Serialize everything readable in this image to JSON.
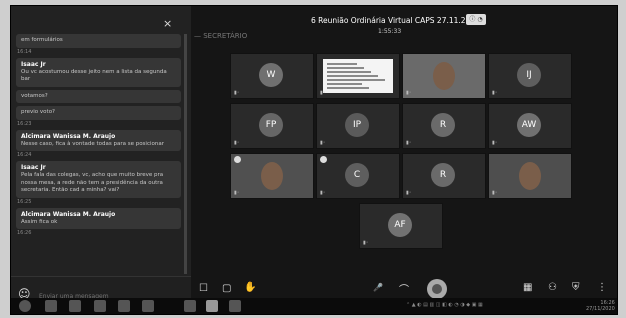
{
  "meeting": {
    "title": "6 Reunião Ordinária Virtual CAPS 27.11.2020",
    "timer": "1:55:33",
    "section_label": "— SECRETÁRIO"
  },
  "chat": {
    "close": "×",
    "messages": [
      {
        "sender": "",
        "text": "em formulários",
        "time": "16:14"
      },
      {
        "sender": "Isaac Jr",
        "text": "Ou vc acostumou desse jeito nem a lista da segunda bar",
        "time": ""
      },
      {
        "sender": "",
        "text": "votamos?",
        "time": ""
      },
      {
        "sender": "",
        "text": "previo voto?",
        "time": "16:23"
      },
      {
        "sender": "Alcimara Wanissa M. Araujo",
        "text": "Nesse caso, fica à vontade todas para se posicionar",
        "time": "16:24"
      },
      {
        "sender": "Isaac Jr",
        "text": "Pela fala das colegas, vc, acho que muito breve pra nossa mesa, a rede não tem a presidência da outra secretaria. Então cad a minha? vai?",
        "time": "16:25"
      },
      {
        "sender": "Alcimara Wanissa M. Araujo",
        "text": "Assim fica ok",
        "time": "16:26"
      }
    ],
    "input_placeholder": "Enviar uma mensagem"
  },
  "participants": [
    {
      "initials": "W",
      "type": "avatar",
      "color": "#707070"
    },
    {
      "initials": "",
      "type": "screen",
      "color": "#f4f4f4"
    },
    {
      "initials": "",
      "type": "video",
      "color": "#6a6a6a"
    },
    {
      "initials": "IJ",
      "type": "avatar",
      "color": "#5e5e5e"
    },
    {
      "initials": "FP",
      "type": "avatar",
      "color": "#666666"
    },
    {
      "initials": "IP",
      "type": "avatar",
      "color": "#5a5a5a"
    },
    {
      "initials": "R",
      "type": "avatar",
      "color": "#6a6a6a"
    },
    {
      "initials": "AW",
      "type": "avatar",
      "color": "#707070"
    },
    {
      "initials": "",
      "type": "video",
      "color": "#505050"
    },
    {
      "initials": "C",
      "type": "avatar",
      "color": "#5e5e5e"
    },
    {
      "initials": "R",
      "type": "avatar",
      "color": "#6a6a6a"
    },
    {
      "initials": "",
      "type": "video",
      "color": "#4e4e4e"
    },
    {
      "initials": "AF",
      "type": "avatar",
      "color": "#727272"
    }
  ],
  "toolbar": {
    "captions_icon": "☐",
    "chat_icon": "▢",
    "hand_icon": "✋",
    "mic_icon": "🎤",
    "camera_icon": "⌒",
    "layout_icon": "▦",
    "people_icon": "⚇",
    "security_icon": "⛨",
    "more_icon": "⋮"
  },
  "taskbar": {
    "tray": "⌃ ▲ ◐ ▤ ▥ ◫ ◧ ◐ ◔ ◑ ◆ ▣ ▦",
    "time": "16:26",
    "date": "27/11/2020"
  }
}
